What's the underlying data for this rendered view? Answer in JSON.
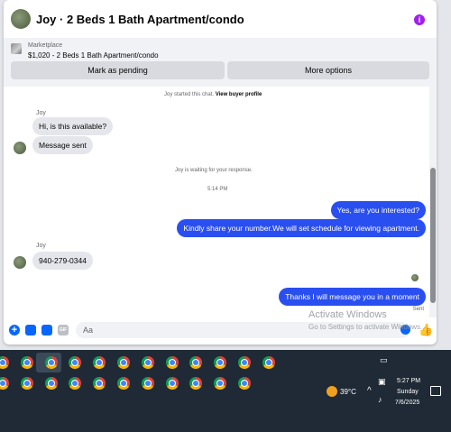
{
  "header": {
    "title": "Joy · 2 Beds 1 Bath Apartment/condo"
  },
  "listing": {
    "label": "Marketplace",
    "title": "$1,020 - 2 Beds 1 Bath Apartment/condo",
    "pending_label": "Mark as pending",
    "more_label": "More options"
  },
  "messages": {
    "started_text": "Joy started this chat.",
    "view_profile": "View buyer profile",
    "sender_name": "Joy",
    "msg1": "Hi, is this available?",
    "msg2": "Message sent",
    "waiting_text": "Joy is waiting for your response.",
    "timestamp": "5:14 PM",
    "reply1": "Yes, are you interested?",
    "reply2": "Kindly share your number.We will set schedule for viewing apartment.",
    "sender_name2": "Joy",
    "phone": "940-279-0344",
    "reply3": "Thanks I will message you in a moment",
    "sent_status": "Sent"
  },
  "composer": {
    "placeholder": "Aa"
  },
  "watermark": {
    "title": "Activate Windows",
    "subtitle": "Go to Settings to activate Windows."
  },
  "taskbar": {
    "temperature": "39°C",
    "time": "5:27 PM",
    "day": "Sunday",
    "date": "7/6/2025"
  },
  "colors": {
    "accent": "#0866ff",
    "outgoing_bubble": "#2a4ff0",
    "info_icon": "#a020f0"
  }
}
